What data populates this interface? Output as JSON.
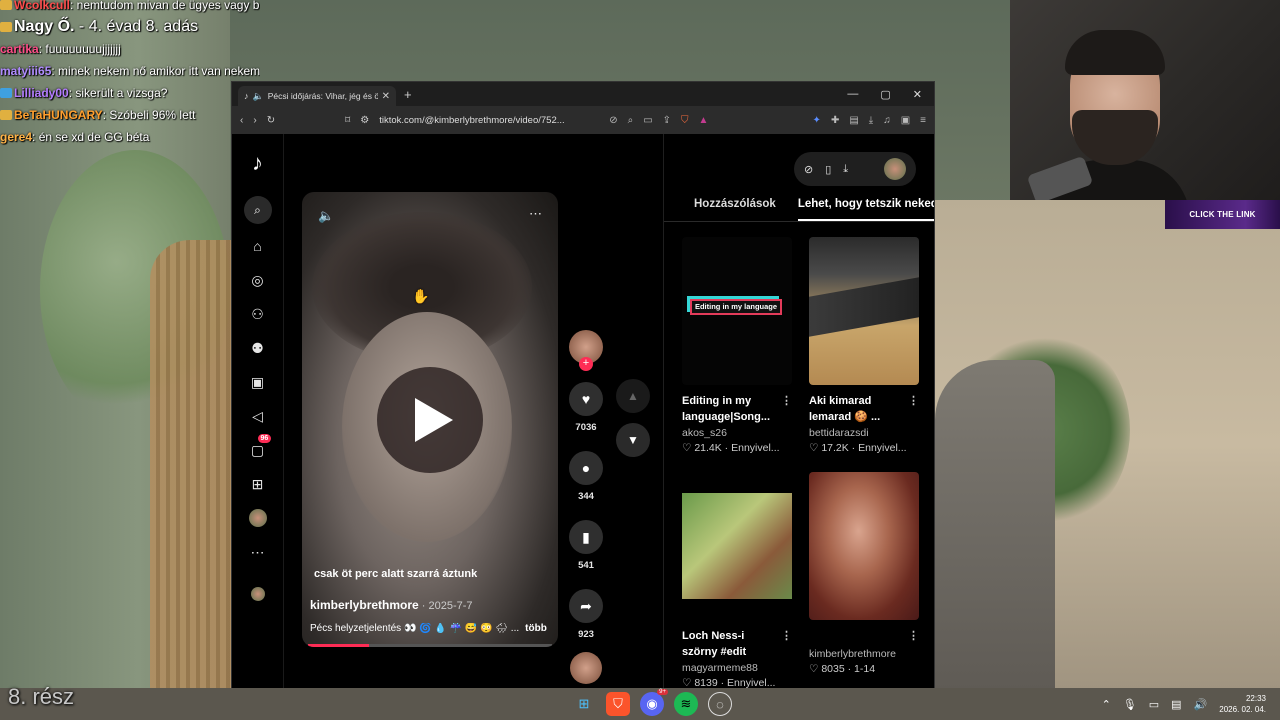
{
  "chat": [
    {
      "user": "Wcolkcull",
      "msg": ": nemtudom mivan de ügyes vagy béta",
      "color": "#ff4d4d"
    },
    {
      "user": "Nagy Ő.",
      "msg": " - 4. évad 8. adás",
      "color": "#ffffff",
      "big": true
    },
    {
      "user": "cartika",
      "msg": ": fuuuuuuuujjjjjjj",
      "color": "#ff4d88"
    },
    {
      "user": "matyiii65",
      "msg": ": minek nekem nő amikor itt van nekem katyvasz",
      "color": "#b08bff"
    },
    {
      "user": "Lilliady00",
      "msg": ": sikerült a vizsga?",
      "color": "#b47cff"
    },
    {
      "user": "BeTaHUNGARY",
      "msg": ": Szóbeli 96% lett",
      "color": "#ff9f2e"
    },
    {
      "user": "gere4",
      "msg": ": én se xd de GG béta",
      "color": "#ffb347"
    }
  ],
  "part_label": "8. rész",
  "click_link": "CLICK THE LINK",
  "browser": {
    "tab_title": "Pécsi időjárás: Vihar, jég és ön…",
    "tab_close": "✕",
    "new_tab": "+",
    "url": "tiktok.com/@kimberlybrethmore/video/752...",
    "win_min": "—",
    "win_max": "▢",
    "win_close": "✕"
  },
  "tiktok": {
    "logo": "♪",
    "notif_count": "96",
    "video": {
      "caption": "csak öt perc alatt szarrá áztunk",
      "author": "kimberlybrethmore",
      "date": " · 2025-7-7",
      "description": "Pécs helyzetjelentés 👀 🌀 💧 ☔ 😅 😳 🌧 ...",
      "more": "több",
      "progress": 0.25
    },
    "actions": {
      "likes": "7036",
      "comments": "344",
      "saves": "541",
      "shares": "923"
    },
    "tabs": [
      "Hozzászólások",
      "Lehet, hogy tetszik neked"
    ],
    "cards": [
      {
        "title": "Editing in my language|Song...",
        "author": "akos_s26",
        "stats": "♡ 21.4K · Ennyivel...",
        "overlay": "Editing in my language"
      },
      {
        "title": "Aki kimarad lemarad 🍪 ...",
        "author": "bettidarazsdi",
        "stats": "♡ 17.2K · Ennyivel..."
      },
      {
        "title": "Loch Ness-i szörny #edit #nekedbe...",
        "author": "magyarmeme88",
        "stats": "♡ 8139 · Ennyivel..."
      },
      {
        "title": "",
        "author": "kimberlybrethmore",
        "stats": "♡ 8035 · 1-14"
      }
    ]
  },
  "taskbar": {
    "time": "22:33",
    "date": "2026. 02. 04.",
    "discord_badge": "9+"
  }
}
